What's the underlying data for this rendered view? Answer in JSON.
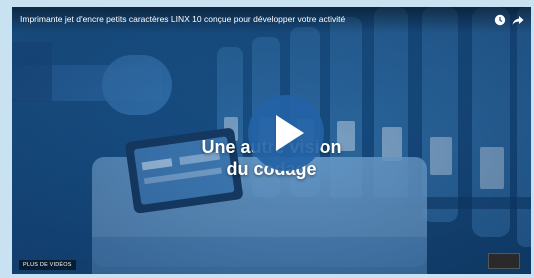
{
  "video": {
    "title": "Imprimante jet d'encre petits caractères LINX 10 conçue pour développer votre activité",
    "overlay_line1": "Une autre vision",
    "overlay_line2": "du codage",
    "more_videos": "PLUS DE VIDÉOS"
  },
  "icons": {
    "watch_later": "clock-icon",
    "share": "share-arrow-icon",
    "play": "play-icon"
  },
  "colors": {
    "tint": "#1a5489",
    "play_button": "#2362a5",
    "page_background": "#c9e2f2"
  }
}
